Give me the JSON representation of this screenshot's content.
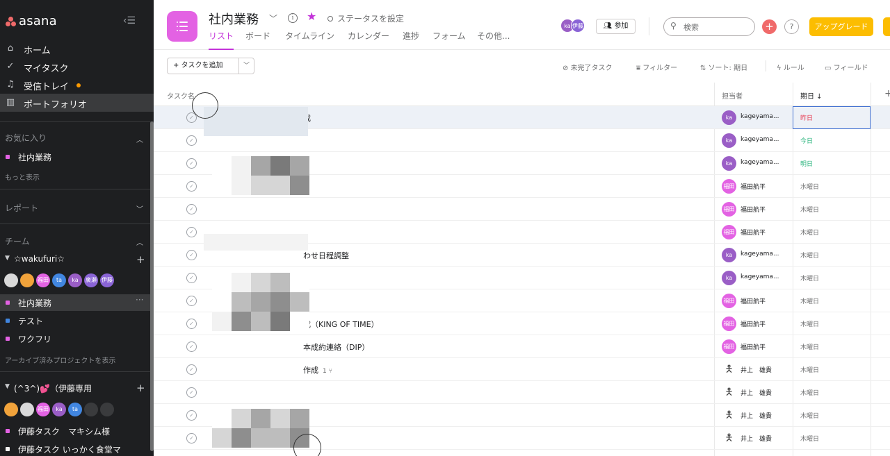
{
  "sidebar": {
    "brand": "asana",
    "nav": [
      {
        "label": "ホーム",
        "icon": "home-icon"
      },
      {
        "label": "マイタスク",
        "icon": "check-circle-icon"
      },
      {
        "label": "受信トレイ",
        "icon": "bell-icon",
        "has_notification": true
      },
      {
        "label": "ポートフォリオ",
        "icon": "bar-chart-icon",
        "active": true
      }
    ],
    "favorites": {
      "heading": "お気に入り",
      "items": [
        {
          "label": "社内業務",
          "color": "#e362e3"
        }
      ],
      "more_link": "もっと表示"
    },
    "reports": {
      "heading": "レポート"
    },
    "teams": {
      "heading": "チーム",
      "team1": {
        "name": "☆wakufuri☆",
        "avatars": [
          {
            "text": "",
            "color": "#d9d9d9"
          },
          {
            "text": "",
            "color": "#f1a33b"
          },
          {
            "text": "福田",
            "color": "#e362e3"
          },
          {
            "text": "ta",
            "color": "#4186e0"
          },
          {
            "text": "ka",
            "color": "#9a5ec6"
          },
          {
            "text": "廣瀬",
            "color": "#8a64d6"
          },
          {
            "text": "伊藤",
            "color": "#8a64d6"
          }
        ],
        "projects": [
          {
            "label": "社内業務",
            "color": "#e362e3",
            "active": true,
            "more": "···"
          },
          {
            "label": "テスト",
            "color": "#4186e0"
          },
          {
            "label": "ワクフリ",
            "color": "#e362e3"
          }
        ],
        "archive_link": "アーカイブ済みプロジェクトを表示"
      },
      "team2": {
        "name": "(^3^)💕（伊藤専用",
        "avatars": [
          {
            "text": "",
            "color": "#f1a33b"
          },
          {
            "text": "",
            "color": "#d9d9d9"
          },
          {
            "text": "福田",
            "color": "#e362e3"
          },
          {
            "text": "ka",
            "color": "#9a5ec6"
          },
          {
            "text": "ta",
            "color": "#4186e0"
          },
          {
            "text": "",
            "color": "#3a3b3d"
          },
          {
            "text": "",
            "color": "#3a3b3d"
          }
        ],
        "projects": [
          {
            "label": "伊藤タスク　マキシム様",
            "color": "#e362e3"
          },
          {
            "label": "伊藤タスク いっかく食堂マ",
            "color": "#f5f4f3"
          }
        ]
      }
    }
  },
  "header": {
    "project_title": "社内業務",
    "status_label": "ステータスを設定",
    "tabs": [
      "リスト",
      "ボード",
      "タイムライン",
      "カレンダー",
      "進捗",
      "フォーム",
      "その他..."
    ],
    "active_tab": "リスト",
    "member_avatars": [
      {
        "text": "ka",
        "color": "#9a5ec6"
      },
      {
        "text": "伊藤",
        "color": "#8a64d6"
      }
    ],
    "join_label": "参加",
    "search_placeholder": "検索",
    "help_label": "?",
    "upgrade_label": "アップグレード",
    "accent": "#c333d9",
    "project_color": "#e362e3"
  },
  "toolbar": {
    "add_task_label": "+ タスクを追加",
    "incomplete_label": "未完了タスク",
    "filter_label": "フィルター",
    "sort_label": "ソート: 期日",
    "rules_label": "ルール",
    "fields_label": "フィールド"
  },
  "table": {
    "columns": {
      "task": "タスク名",
      "assignee": "担当者",
      "due": "期日 ↓",
      "add": "+"
    },
    "rows": [
      {
        "name": "成",
        "sub": "",
        "assignee": "kageyama...",
        "avatar": "ka",
        "avatar_color": "#9a5ec6",
        "due": "昨日",
        "due_kind": "past",
        "selected": true
      },
      {
        "name": "",
        "sub": "",
        "assignee": "kageyama...",
        "avatar": "ka",
        "avatar_color": "#9a5ec6",
        "due": "今日",
        "due_kind": "today"
      },
      {
        "name": "",
        "sub": "",
        "assignee": "kageyama...",
        "avatar": "ka",
        "avatar_color": "#9a5ec6",
        "due": "明日",
        "due_kind": "tomorrow"
      },
      {
        "name": "",
        "sub": "",
        "assignee": "福田航平",
        "avatar": "福田",
        "avatar_color": "#e362e3",
        "due": "水曜日",
        "due_kind": "normal"
      },
      {
        "name": "",
        "sub": "",
        "assignee": "福田航平",
        "avatar": "福田",
        "avatar_color": "#e362e3",
        "due": "木曜日",
        "due_kind": "normal"
      },
      {
        "name": "",
        "sub": "",
        "assignee": "福田航平",
        "avatar": "福田",
        "avatar_color": "#e362e3",
        "due": "木曜日",
        "due_kind": "normal"
      },
      {
        "name": "わせ日程調整",
        "sub": "",
        "assignee": "kageyama...",
        "avatar": "ka",
        "avatar_color": "#9a5ec6",
        "due": "木曜日",
        "due_kind": "normal"
      },
      {
        "name": "",
        "sub": "",
        "assignee": "kageyama...",
        "avatar": "ka",
        "avatar_color": "#9a5ec6",
        "due": "木曜日",
        "due_kind": "normal"
      },
      {
        "name": "",
        "sub": "",
        "assignee": "福田航平",
        "avatar": "福田",
        "avatar_color": "#e362e3",
        "due": "木曜日",
        "due_kind": "normal"
      },
      {
        "name": "成（KING OF TIME）",
        "sub": "",
        "assignee": "福田航平",
        "avatar": "福田",
        "avatar_color": "#e362e3",
        "due": "木曜日",
        "due_kind": "normal"
      },
      {
        "name": "本成約連絡（DIP）",
        "sub": "",
        "assignee": "福田航平",
        "avatar": "福田",
        "avatar_color": "#e362e3",
        "due": "木曜日",
        "due_kind": "normal"
      },
      {
        "name": "作成",
        "sub": "1 ⑂",
        "assignee": "井上　雄貴",
        "avatar": "",
        "avatar_color": "",
        "due": "木曜日",
        "due_kind": "normal"
      },
      {
        "name": "",
        "sub": "",
        "assignee": "井上　雄貴",
        "avatar": "",
        "avatar_color": "",
        "due": "木曜日",
        "due_kind": "normal"
      },
      {
        "name": "",
        "sub": "",
        "assignee": "井上　雄貴",
        "avatar": "",
        "avatar_color": "",
        "due": "木曜日",
        "due_kind": "normal"
      },
      {
        "name": "",
        "sub": "",
        "assignee": "井上　雄貴",
        "avatar": "",
        "avatar_color": "",
        "due": "木曜日",
        "due_kind": "normal"
      }
    ]
  }
}
